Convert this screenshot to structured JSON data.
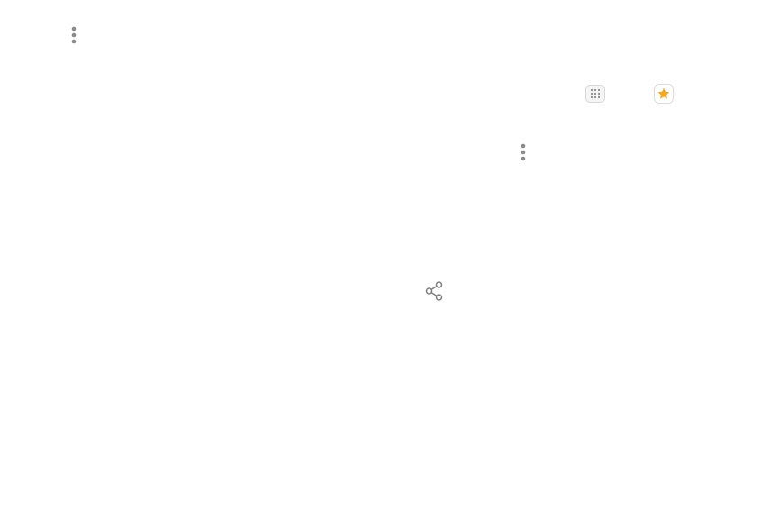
{
  "icons": {
    "more_top": "more-options-icon",
    "apps": "apps-grid-icon",
    "favorite_app": "star-app-icon",
    "more_mid": "more-options-icon",
    "share": "share-icon"
  },
  "colors": {
    "icon_gray": "#8a8a8a",
    "star_orange": "#f5a623",
    "background": "#ffffff"
  }
}
